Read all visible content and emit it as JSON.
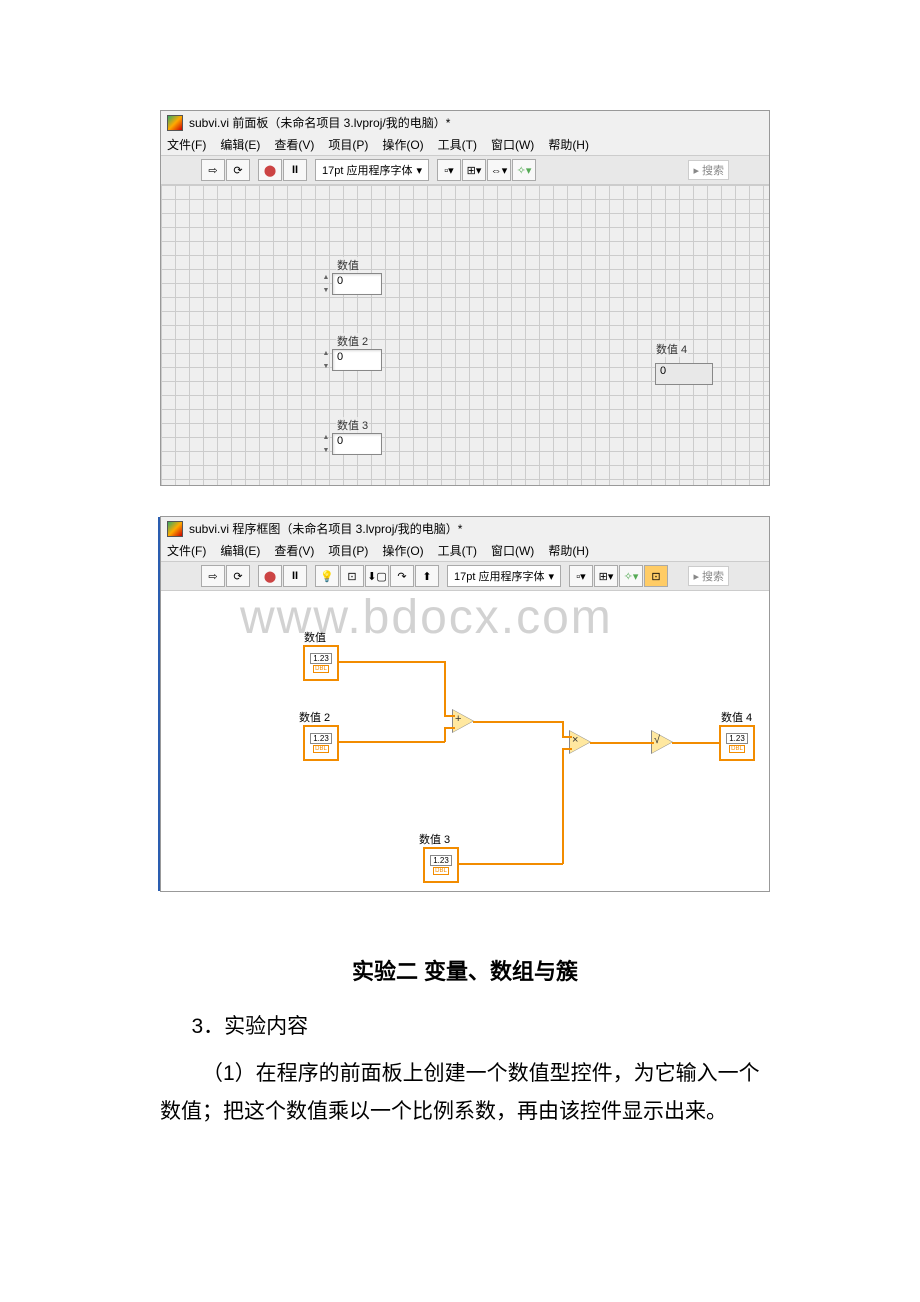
{
  "watermark": "www.bdocx.com",
  "front_panel": {
    "title": "subvi.vi 前面板（未命名项目 3.lvproj/我的电脑）*",
    "menu": [
      "文件(F)",
      "编辑(E)",
      "查看(V)",
      "项目(P)",
      "操作(O)",
      "工具(T)",
      "窗口(W)",
      "帮助(H)"
    ],
    "font": "17pt 应用程序字体",
    "search_placeholder": "搜索",
    "controls": {
      "c1": {
        "label": "数值",
        "value": "0"
      },
      "c2": {
        "label": "数值 2",
        "value": "0"
      },
      "c3": {
        "label": "数值 3",
        "value": "0"
      },
      "ind": {
        "label": "数值 4",
        "value": "0"
      }
    }
  },
  "block_diagram": {
    "title": "subvi.vi 程序框图（未命名项目 3.lvproj/我的电脑）*",
    "menu": [
      "文件(F)",
      "编辑(E)",
      "查看(V)",
      "项目(P)",
      "操作(O)",
      "工具(T)",
      "窗口(W)",
      "帮助(H)"
    ],
    "font": "17pt 应用程序字体",
    "search_placeholder": "搜索",
    "nodes": {
      "n1": {
        "label": "数值",
        "display": "1.23",
        "type": "DBL"
      },
      "n2": {
        "label": "数值 2",
        "display": "1.23",
        "type": "DBL"
      },
      "n3": {
        "label": "数值 3",
        "display": "1.23",
        "type": "DBL"
      },
      "n4": {
        "label": "数值 4",
        "display": "1.23",
        "type": "DBL"
      }
    },
    "ops": {
      "add": "+",
      "mul": "×",
      "sqrt": "√"
    }
  },
  "body": {
    "heading": "实验二 变量、数组与簇",
    "p1": "3．实验内容",
    "p2": "（1）在程序的前面板上创建一个数值型控件，为它输入一个数值；把这个数值乘以一个比例系数，再由该控件显示出来。"
  }
}
